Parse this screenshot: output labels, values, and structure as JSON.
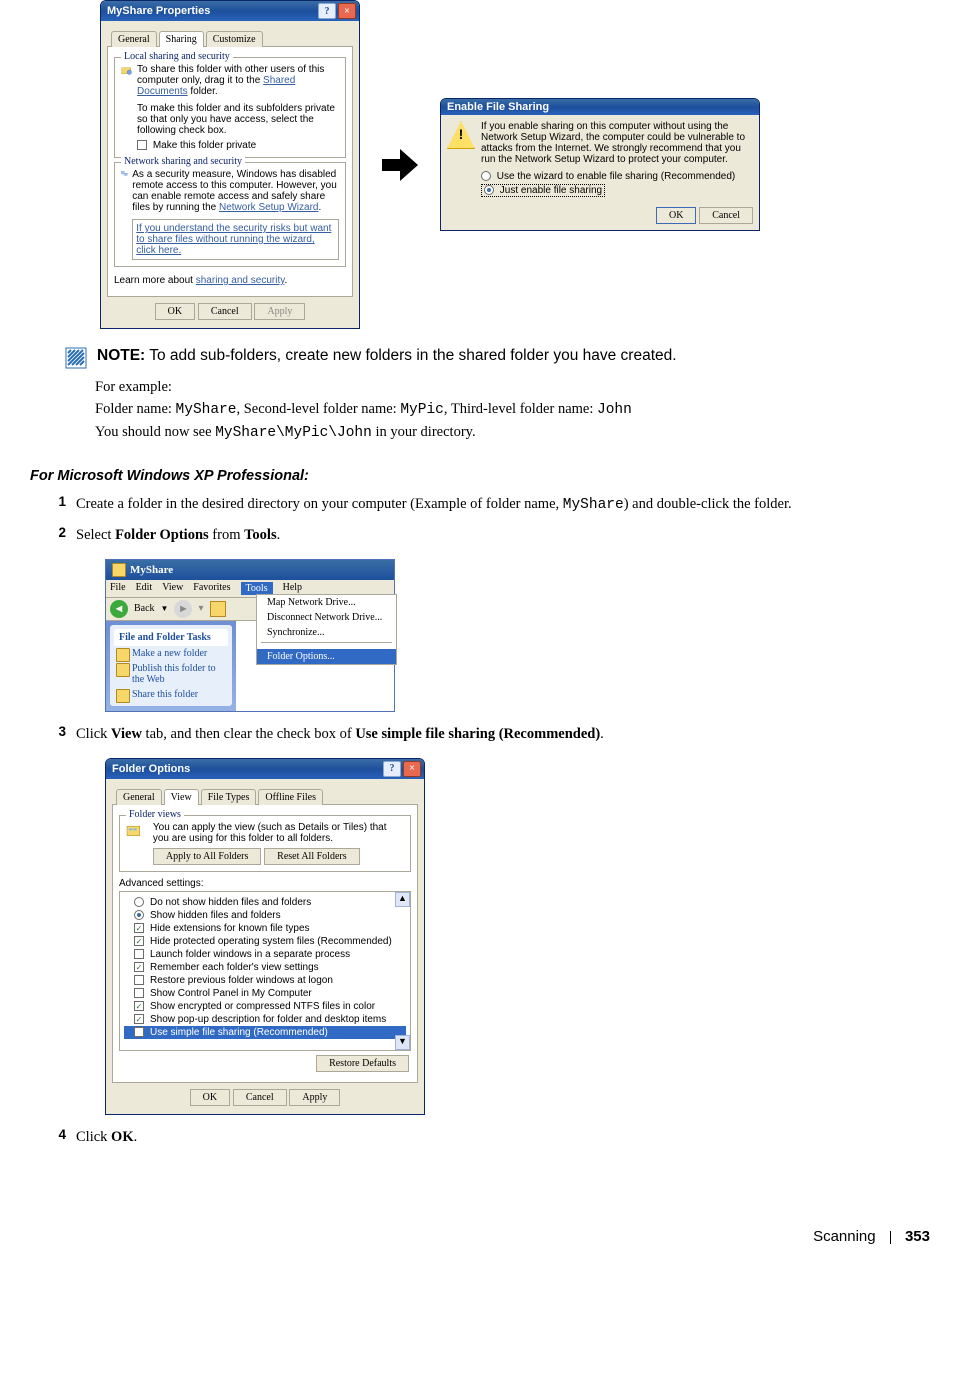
{
  "props_dialog": {
    "title": "MyShare Properties",
    "tabs": [
      "General",
      "Sharing",
      "Customize"
    ],
    "active_tab": "Sharing",
    "group1_title": "Local sharing and security",
    "g1_line1": "To share this folder with other users of this computer only, drag it to the",
    "g1_link1": "Shared Documents",
    "g1_line1b": "folder.",
    "g1_line2": "To make this folder and its subfolders private so that only you have access, select the following check box.",
    "g1_chk": "Make this folder private",
    "group2_title": "Network sharing and security",
    "g2_line1": "As a security measure, Windows has disabled remote access to this computer. However, you can enable remote access and safely share files by running the",
    "g2_link1": "Network Setup Wizard",
    "g2_linkbox": "If you understand the security risks but want to share files without running the wizard, click here.",
    "learn": "Learn more about",
    "learn_link": "sharing and security",
    "ok": "OK",
    "cancel": "Cancel",
    "apply": "Apply"
  },
  "enable_dialog": {
    "title": "Enable File Sharing",
    "body": "If you enable sharing on this computer without using the Network Setup Wizard, the computer could be vulnerable to attacks from the Internet. We strongly recommend that you run the Network Setup Wizard to protect your computer.",
    "opt1": "Use the wizard to enable file sharing (Recommended)",
    "opt2": "Just enable file sharing",
    "ok": "OK",
    "cancel": "Cancel"
  },
  "note": {
    "label": "NOTE:",
    "text": " To add sub-folders, create new folders in the shared folder you have created.",
    "eg_intro": "For example:",
    "eg_fn_l": "Folder name: ",
    "eg_fn_v": "MyShare",
    "eg_sep1": ", Second-level folder name: ",
    "eg_s2_v": "MyPic",
    "eg_sep2": ", Third-level folder name: ",
    "eg_s3_v": "John",
    "eg_l2a": "You should now see ",
    "eg_path": "MyShare\\MyPic\\John",
    "eg_l2b": " in your directory."
  },
  "section_heading": "For Microsoft Windows XP Professional:",
  "steps": {
    "s1a": "Create a folder in the desired directory on your computer (Example of folder name, ",
    "s1mono": "MyShare",
    "s1b": ") and double-click the folder.",
    "s2a": "Select ",
    "s2b": "Folder Options",
    "s2c": " from ",
    "s2d": "Tools",
    "s2e": ".",
    "s3a": "Click ",
    "s3b": "View",
    "s3c": " tab, and then clear the check box of ",
    "s3d": "Use simple file sharing (Recommended)",
    "s3e": ".",
    "s4a": "Click ",
    "s4b": "OK",
    "s4c": "."
  },
  "explorer": {
    "title": "MyShare",
    "menu": [
      "File",
      "Edit",
      "View",
      "Favorites",
      "Tools",
      "Help"
    ],
    "back": "Back",
    "tools_menu": [
      "Map Network Drive...",
      "Disconnect Network Drive...",
      "Synchronize...",
      "Folder Options..."
    ],
    "side_hdr": "File and Folder Tasks",
    "side_items": [
      "Make a new folder",
      "Publish this folder to the Web",
      "Share this folder"
    ]
  },
  "folder_opts": {
    "title": "Folder Options",
    "tabs": [
      "General",
      "View",
      "File Types",
      "Offline Files"
    ],
    "active": "View",
    "fv_title": "Folder views",
    "fv_text": "You can apply the view (such as Details or Tiles) that you are using for this folder to all folders.",
    "apply_all": "Apply to All Folders",
    "reset_all": "Reset All Folders",
    "adv_label": "Advanced settings:",
    "adv": [
      {
        "kind": "rad",
        "sel": false,
        "t": "Do not show hidden files and folders"
      },
      {
        "kind": "rad",
        "sel": true,
        "t": "Show hidden files and folders"
      },
      {
        "kind": "chk",
        "sel": true,
        "t": "Hide extensions for known file types"
      },
      {
        "kind": "chk",
        "sel": true,
        "t": "Hide protected operating system files (Recommended)"
      },
      {
        "kind": "chk",
        "sel": false,
        "t": "Launch folder windows in a separate process"
      },
      {
        "kind": "chk",
        "sel": true,
        "t": "Remember each folder's view settings"
      },
      {
        "kind": "chk",
        "sel": false,
        "t": "Restore previous folder windows at logon"
      },
      {
        "kind": "chk",
        "sel": false,
        "t": "Show Control Panel in My Computer"
      },
      {
        "kind": "chk",
        "sel": true,
        "t": "Show encrypted or compressed NTFS files in color"
      },
      {
        "kind": "chk",
        "sel": true,
        "t": "Show pop-up description for folder and desktop items"
      },
      {
        "kind": "chk",
        "sel": false,
        "t": "Use simple file sharing (Recommended)"
      }
    ],
    "restore": "Restore Defaults",
    "ok": "OK",
    "cancel": "Cancel",
    "apply": "Apply"
  },
  "footer": {
    "section": "Scanning",
    "page": "353"
  }
}
